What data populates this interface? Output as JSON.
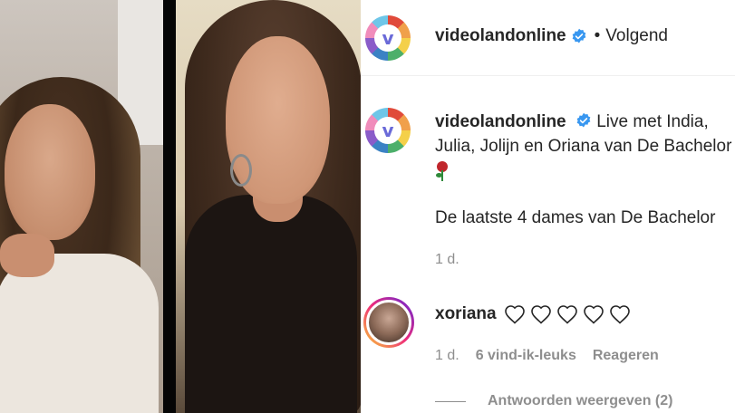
{
  "media": {
    "description_icon_left": "person-video-left",
    "description_icon_right": "person-video-right"
  },
  "header": {
    "username": "videolandonline",
    "verified_icon": "verified-badge-icon",
    "dot": "•",
    "follow_status": "Volgend"
  },
  "caption": {
    "username": "videolandonline",
    "line1": "Live met India,",
    "line2": "Julia, Jolijn en Oriana van De Bachelor",
    "emoji": "rose-emoji",
    "second_paragraph": "De laatste 4 dames van De Bachelor",
    "time": "1 d."
  },
  "comment": {
    "username": "xoriana",
    "hearts_count": 5,
    "time": "1 d.",
    "likes": "6 vind-ik-leuks",
    "reply": "Reageren",
    "view_replies": "Antwoorden weergeven (2)"
  },
  "colors": {
    "verified_blue": "#3897f0",
    "text_primary": "#262626",
    "text_secondary": "#8e8e8e"
  }
}
